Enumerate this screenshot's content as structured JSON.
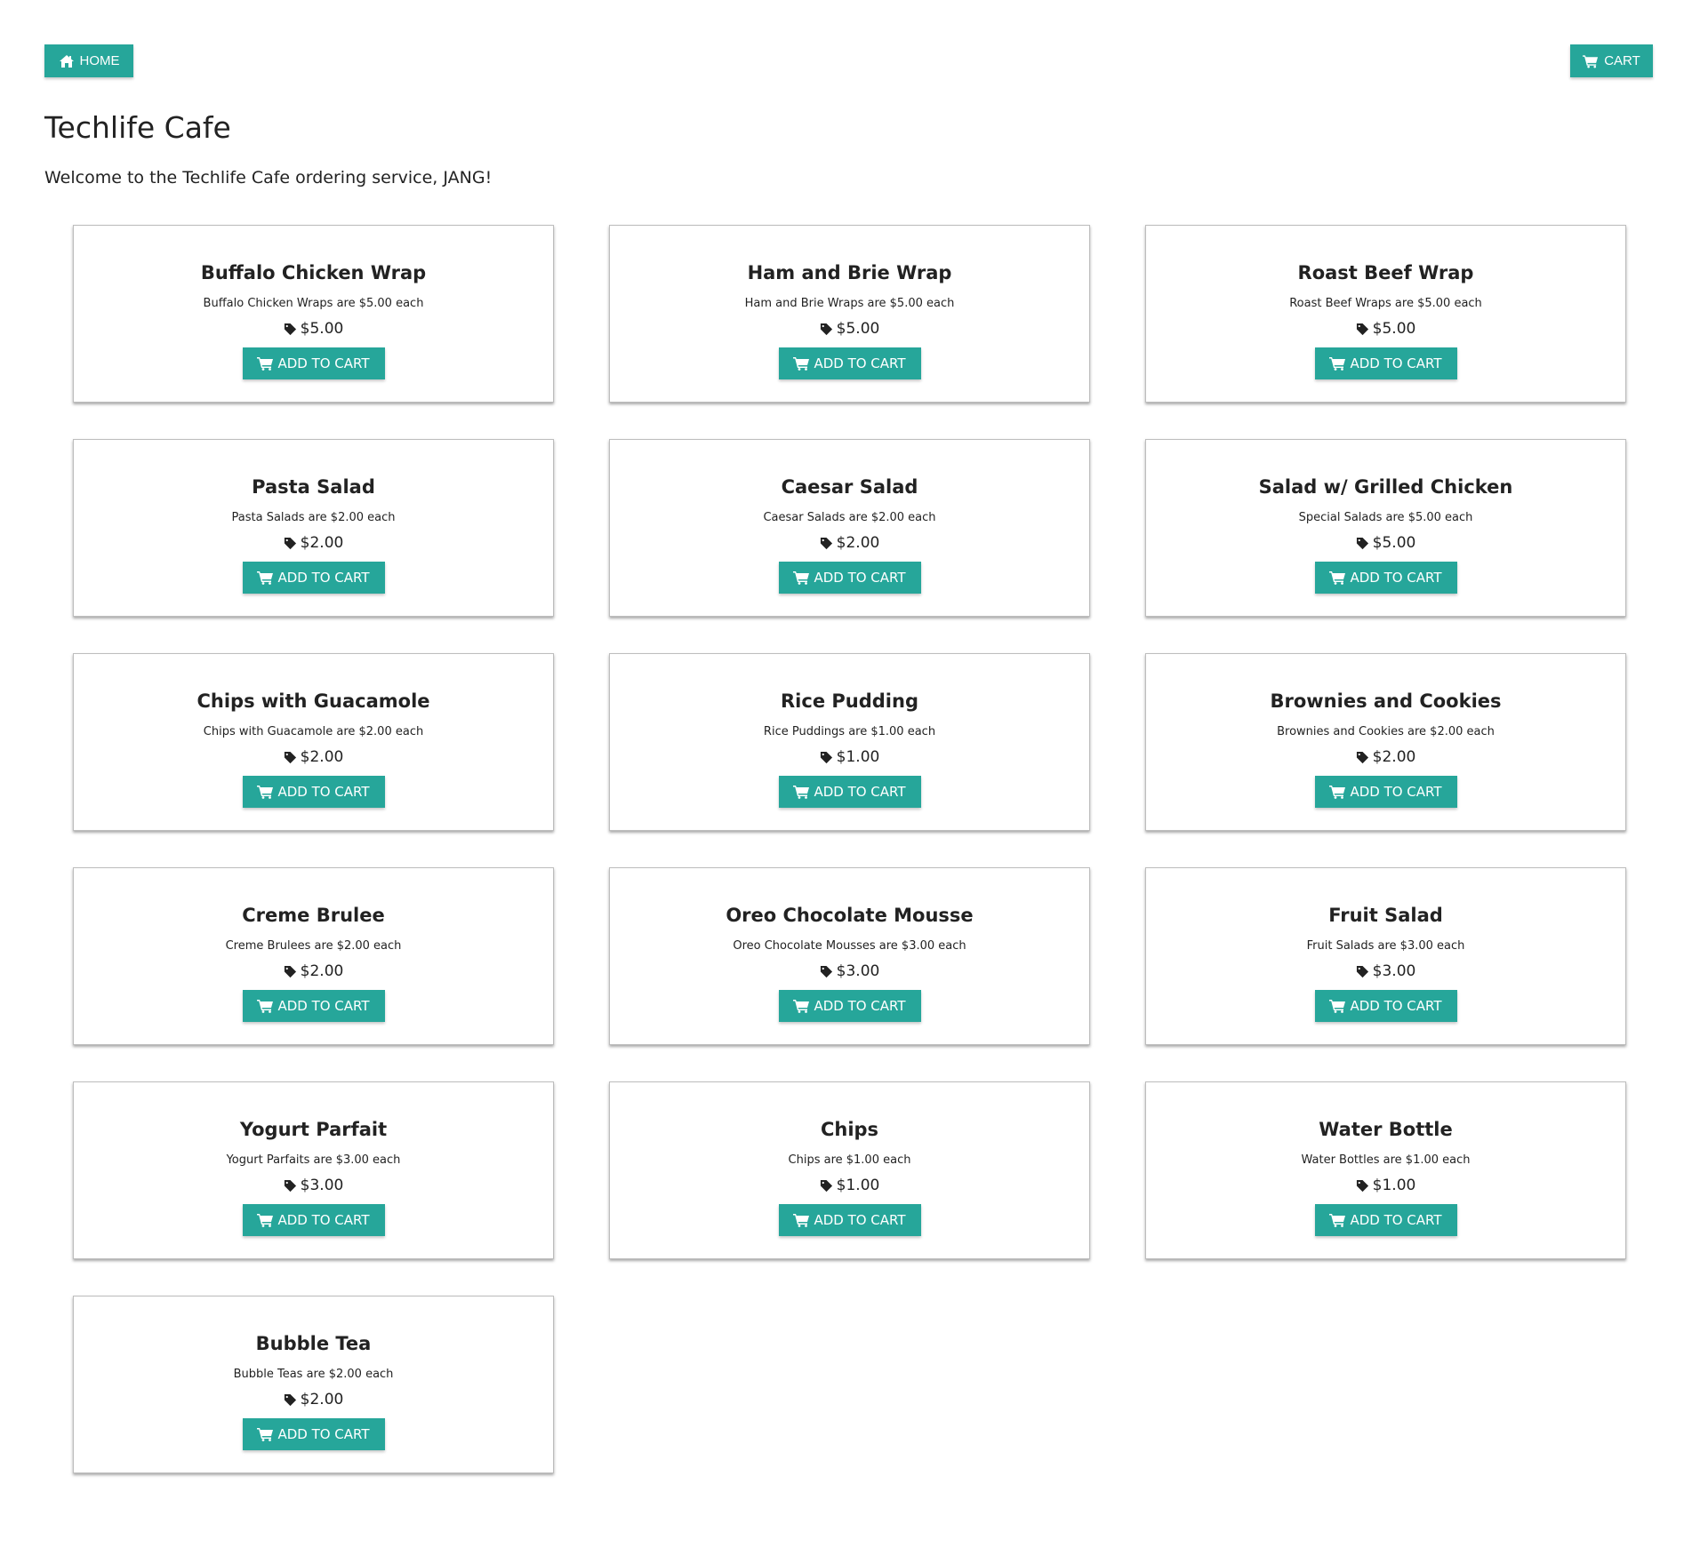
{
  "colors": {
    "accent": "#26a69a",
    "text": "#222222",
    "card_border": "#bdbdbd"
  },
  "nav": {
    "home_label": "HOME",
    "home_icon": "home-icon",
    "cart_label": "CART",
    "cart_icon": "shopping-cart-icon"
  },
  "header": {
    "title": "Techlife Cafe",
    "welcome": "Welcome to the Techlife Cafe ordering service, JANG!"
  },
  "menu": {
    "add_label": "ADD TO CART",
    "price_icon": "tag-icon",
    "items": [
      {
        "name": "Buffalo Chicken Wrap",
        "desc": "Buffalo Chicken Wraps are $5.00 each",
        "price": "$5.00"
      },
      {
        "name": "Ham and Brie Wrap",
        "desc": "Ham and Brie Wraps are $5.00 each",
        "price": "$5.00"
      },
      {
        "name": "Roast Beef Wrap",
        "desc": "Roast Beef Wraps are $5.00 each",
        "price": "$5.00"
      },
      {
        "name": "Pasta Salad",
        "desc": "Pasta Salads are $2.00 each",
        "price": "$2.00"
      },
      {
        "name": "Caesar Salad",
        "desc": "Caesar Salads are $2.00 each",
        "price": "$2.00"
      },
      {
        "name": "Salad w/ Grilled Chicken",
        "desc": "Special Salads are $5.00 each",
        "price": "$5.00"
      },
      {
        "name": "Chips with Guacamole",
        "desc": "Chips with Guacamole are $2.00 each",
        "price": "$2.00"
      },
      {
        "name": "Rice Pudding",
        "desc": "Rice Puddings are $1.00 each",
        "price": "$1.00"
      },
      {
        "name": "Brownies and Cookies",
        "desc": "Brownies and Cookies are $2.00 each",
        "price": "$2.00"
      },
      {
        "name": "Creme Brulee",
        "desc": "Creme Brulees are $2.00 each",
        "price": "$2.00"
      },
      {
        "name": "Oreo Chocolate Mousse",
        "desc": "Oreo Chocolate Mousses are $3.00 each",
        "price": "$3.00"
      },
      {
        "name": "Fruit Salad",
        "desc": "Fruit Salads are $3.00 each",
        "price": "$3.00"
      },
      {
        "name": "Yogurt Parfait",
        "desc": "Yogurt Parfaits are $3.00 each",
        "price": "$3.00"
      },
      {
        "name": "Chips",
        "desc": "Chips are $1.00 each",
        "price": "$1.00"
      },
      {
        "name": "Water Bottle",
        "desc": "Water Bottles are $1.00 each",
        "price": "$1.00"
      },
      {
        "name": "Bubble Tea",
        "desc": "Bubble Teas are $2.00 each",
        "price": "$2.00"
      }
    ]
  }
}
